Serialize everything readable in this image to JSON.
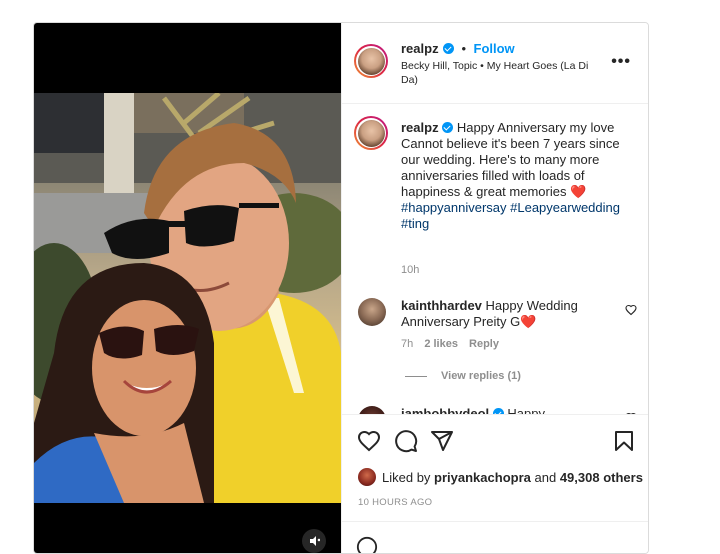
{
  "post": {
    "username": "realpz",
    "follow_label": "Follow",
    "separator": "•",
    "music": "Becky Hill, Topic • My Heart Goes (La Di Da)",
    "more_label": "•••"
  },
  "caption": {
    "username": "realpz",
    "text": "Happy Anniversary my love Cannot believe it's been 7 years since our wedding. Here's to many more anniversaries filled with loads of happiness & great memories",
    "emoji": "❤️",
    "hashtags": "#happyanniversay #Leapyearwedding #ting",
    "time": "10h"
  },
  "comments": [
    {
      "username": "kainthhardev",
      "text": "Happy Wedding Anniversary Preity G",
      "emoji": "❤️",
      "time": "7h",
      "likes": "2 likes",
      "reply": "Reply"
    },
    {
      "username": "iambobbydeol",
      "text": "Happy anniversary 👏🏼🙌🏼👏🏼🙌🏼👏🏼🙌🏼🙏🏼"
    }
  ],
  "view_replies": "View replies (1)",
  "likes": {
    "prefix": "Liked by",
    "user": "priyankachopra",
    "and": "and",
    "count": "49,308 others"
  },
  "timestamp": "10 HOURS AGO",
  "icons": [
    "heart-icon",
    "comment-icon",
    "share-icon",
    "bookmark-icon",
    "more-icon",
    "audio-icon"
  ],
  "colors": {
    "accent": "#0095f6",
    "heart": "#ed4956",
    "muted": "#8e8e8e",
    "hashtag": "#00376b"
  }
}
